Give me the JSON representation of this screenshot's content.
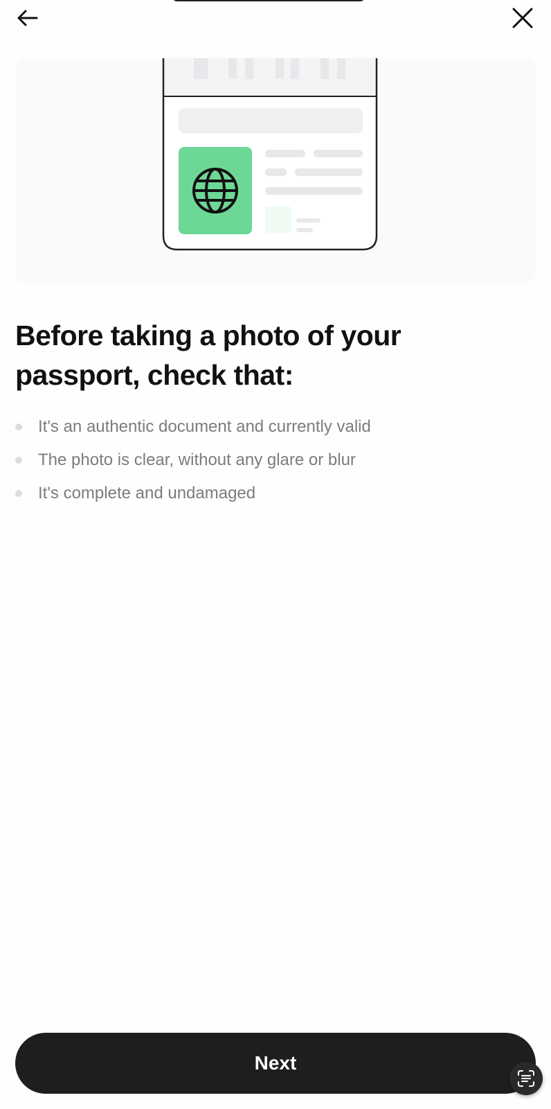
{
  "header": {
    "back_icon": "arrow-left-icon",
    "close_icon": "close-icon"
  },
  "illustration": {
    "document_icon": "globe-icon",
    "photo_color": "#6dd796"
  },
  "headline": "Before taking a photo of your passport, check that:",
  "checklist": [
    "It's an authentic document and currently valid",
    "The photo is clear, without any glare or blur",
    "It's complete and undamaged"
  ],
  "footer": {
    "next_label": "Next",
    "scan_icon": "text-scan-icon"
  },
  "colors": {
    "button_bg": "#1e1d1f",
    "headline": "#111111",
    "body_text": "#7c7c80",
    "accent_green": "#6dd796"
  }
}
